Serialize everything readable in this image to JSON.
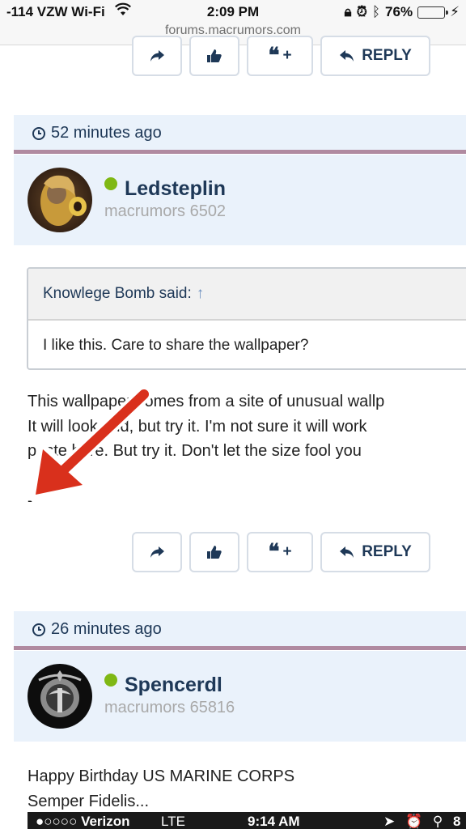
{
  "status_bar": {
    "carrier": "-114 VZW Wi-Fi",
    "time": "2:09 PM",
    "battery": "76%",
    "url": "forums.macrumors.com"
  },
  "actions": {
    "reply_label": "REPLY",
    "quote_plus": "+"
  },
  "posts": [
    {
      "time": "52 minutes ago",
      "username": "Ledsteplin",
      "user_title": "macrumors 6502",
      "quote": {
        "author": "Knowlege Bomb said:",
        "arrow": "↑",
        "text": "I like this. Care to share the wallpaper?"
      },
      "body_lines": [
        "This wallpaper comes from a site of unusual wallp",
        "It will look odd, but try it. I'm not sure it will work",
        "paste here. But try it. Don't let the size fool you"
      ],
      "signature": "-"
    },
    {
      "time": "26 minutes ago",
      "username": "Spencerdl",
      "user_title": "macrumors 65816",
      "body_lines": [
        "Happy Birthday US MARINE CORPS",
        "Semper Fidelis..."
      ]
    }
  ],
  "embedded_screenshot": {
    "carrier": "●○○○○ Verizon",
    "network": "LTE",
    "time": "9:14 AM",
    "icons": "➤ ⏰ ⚲ 8"
  },
  "colors": {
    "brand_navy": "#1e3857",
    "post_header_bg": "#eaf2fb",
    "divider_mauve": "#b08aa0",
    "online_green": "#7fb814",
    "annotation_red": "#d9301c"
  }
}
